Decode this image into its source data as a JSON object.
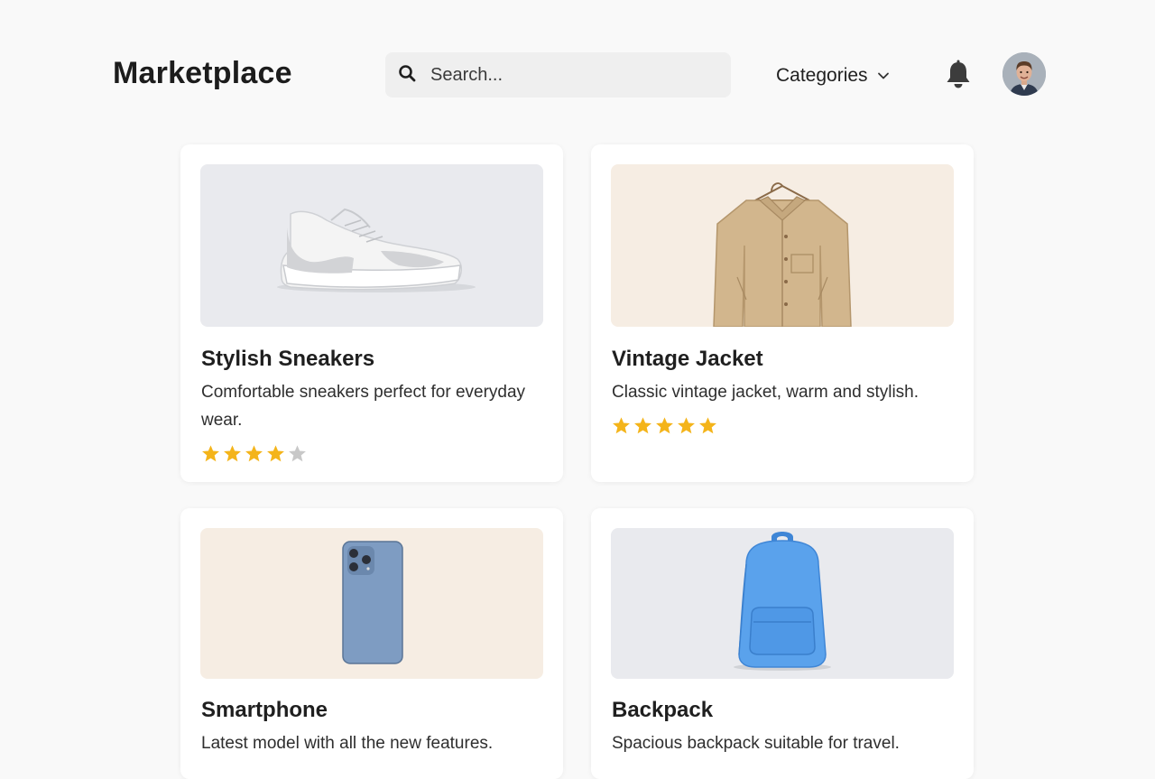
{
  "header": {
    "brand": "Marketplace",
    "search_placeholder": "Search...",
    "categories_label": "Categories"
  },
  "colors": {
    "star_filled": "#f4b41a",
    "star_empty": "#c8c8c8",
    "thumb_gray": "#e9eaee",
    "thumb_beige": "#f6ede3"
  },
  "icons": [
    "search-icon",
    "chevron-down-icon",
    "bell-icon",
    "avatar"
  ],
  "products": [
    {
      "title": "Stylish Sneakers",
      "desc": "Comfortable sneakers perfect for everyday wear.",
      "rating": 4,
      "max_rating": 5
    },
    {
      "title": "Vintage Jacket",
      "desc": "Classic vintage jacket, warm and stylish.",
      "rating": 5,
      "max_rating": 5
    },
    {
      "title": "Smartphone",
      "desc": "Latest model with all the new features."
    },
    {
      "title": "Backpack",
      "desc": "Spacious backpack suitable for travel."
    }
  ]
}
